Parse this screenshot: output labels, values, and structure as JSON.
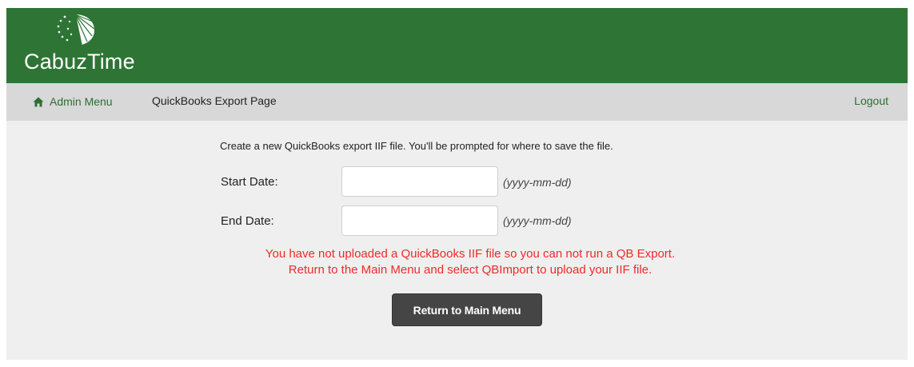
{
  "header": {
    "logo_text": "CabuzTime",
    "logo_icon": "sunburst-fan-logo",
    "background_color": "#2e7535"
  },
  "nav": {
    "home_icon": "home-icon",
    "home_label": "Admin Menu",
    "page_title": "QuickBooks Export Page",
    "logout_label": "Logout",
    "link_color": "#2e6e33"
  },
  "form": {
    "intro": "Create a new QuickBooks export IIF file. You'll be prompted for where to save the file.",
    "start_date": {
      "label": "Start Date:",
      "value": "",
      "hint": "(yyyy-mm-dd)"
    },
    "end_date": {
      "label": "End Date:",
      "value": "",
      "hint": "(yyyy-mm-dd)"
    }
  },
  "warning": {
    "line1": "You have not uploaded a QuickBooks IIF file so you can not run a QB Export.",
    "line2": "Return to the Main Menu and select QBImport to upload your IIF file.",
    "color": "#ee2a2a"
  },
  "actions": {
    "return_label": "Return to Main Menu"
  }
}
